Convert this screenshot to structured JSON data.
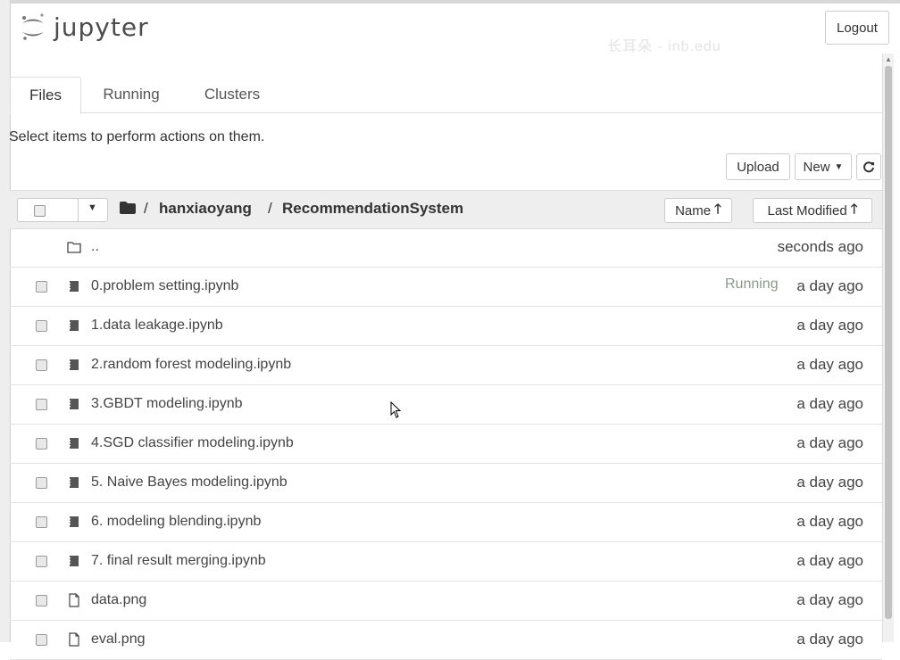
{
  "header": {
    "app_name": "jupyter",
    "logout_label": "Logout",
    "watermark": "长耳朵 - inb.edu"
  },
  "tabs": [
    {
      "label": "Files",
      "active": true
    },
    {
      "label": "Running",
      "active": false
    },
    {
      "label": "Clusters",
      "active": false
    }
  ],
  "hint_text": "Select items to perform actions on them.",
  "toolbar": {
    "upload_label": "Upload",
    "new_label": "New",
    "refresh_icon": "refresh-icon"
  },
  "breadcrumb": {
    "root_icon": "folder-icon",
    "sep": "/",
    "parts": [
      "hanxiaoyang",
      "RecommendationSystem"
    ]
  },
  "sort": {
    "name_label": "Name",
    "modified_label": "Last Modified"
  },
  "rows": [
    {
      "type": "parent",
      "icon": "folder-open-icon",
      "name": "..",
      "status": "",
      "modified": "seconds ago"
    },
    {
      "type": "notebook",
      "icon": "notebook-icon",
      "name": "0.problem setting.ipynb",
      "status": "Running",
      "modified": "a day ago"
    },
    {
      "type": "notebook",
      "icon": "notebook-icon",
      "name": "1.data leakage.ipynb",
      "status": "",
      "modified": "a day ago"
    },
    {
      "type": "notebook",
      "icon": "notebook-icon",
      "name": "2.random forest modeling.ipynb",
      "status": "",
      "modified": "a day ago"
    },
    {
      "type": "notebook",
      "icon": "notebook-icon",
      "name": "3.GBDT modeling.ipynb",
      "status": "",
      "modified": "a day ago"
    },
    {
      "type": "notebook",
      "icon": "notebook-icon",
      "name": "4.SGD classifier modeling.ipynb",
      "status": "",
      "modified": "a day ago"
    },
    {
      "type": "notebook",
      "icon": "notebook-icon",
      "name": "5. Naive Bayes modeling.ipynb",
      "status": "",
      "modified": "a day ago"
    },
    {
      "type": "notebook",
      "icon": "notebook-icon",
      "name": "6. modeling blending.ipynb",
      "status": "",
      "modified": "a day ago"
    },
    {
      "type": "notebook",
      "icon": "notebook-icon",
      "name": "7. final result merging.ipynb",
      "status": "",
      "modified": "a day ago"
    },
    {
      "type": "file",
      "icon": "file-icon",
      "name": "data.png",
      "status": "",
      "modified": "a day ago"
    },
    {
      "type": "file",
      "icon": "file-icon",
      "name": "eval.png",
      "status": "",
      "modified": "a day ago"
    }
  ],
  "colors": {
    "header_bg": "#eeeeee",
    "running_text": "#8a9a8a",
    "logo_orange": "#f37726"
  }
}
